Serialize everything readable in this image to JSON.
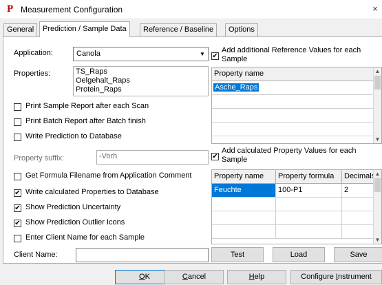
{
  "window": {
    "title": "Measurement Configuration",
    "logo": "P",
    "close_glyph": "×"
  },
  "tabs": [
    {
      "label": "General",
      "active": false
    },
    {
      "label": "Prediction / Sample Data",
      "active": true
    },
    {
      "label": "Reference / Baseline",
      "active": false
    },
    {
      "label": "Options",
      "active": false
    }
  ],
  "application": {
    "label": "Application:",
    "value": "Canola"
  },
  "properties": {
    "label": "Properties:",
    "items": [
      "TS_Raps",
      "Oelgehalt_Raps",
      "Protein_Raps"
    ]
  },
  "checks_top": [
    {
      "label": "Print Sample Report after each Scan",
      "checked": false
    },
    {
      "label": "Print Batch Report after Batch finish",
      "checked": false
    },
    {
      "label": "Write Prediction to Database",
      "checked": false
    }
  ],
  "property_suffix": {
    "label": "Property suffix:",
    "value": "-Vorh"
  },
  "checks_bottom": [
    {
      "label": "Get Formula Filename from Application Comment",
      "checked": false
    },
    {
      "label": "Write calculated Properties to Database",
      "checked": true
    },
    {
      "label": "Show Prediction Uncertainty",
      "checked": true
    },
    {
      "label": "Show Prediction Outlier Icons",
      "checked": true
    },
    {
      "label": "Enter Client Name for each Sample",
      "checked": false
    }
  ],
  "client_name": {
    "label": "Client Name:",
    "value": ""
  },
  "ref_values": {
    "check_label_1": "Add additional Reference Values for each",
    "check_label_2": "Sample",
    "checked": true,
    "column": "Property name",
    "rows": [
      "Asche_Raps"
    ]
  },
  "calc_values": {
    "check_label_1": "Add calculated Property Values for each",
    "check_label_2": "Sample",
    "checked": true,
    "columns": [
      "Property name",
      "Property formula",
      "Decimals"
    ],
    "rows": [
      [
        "Feuchte",
        "100-P1",
        "2"
      ]
    ]
  },
  "grid_buttons": {
    "test": "Test",
    "load": "Load",
    "save": "Save"
  },
  "footer": {
    "ok": "OK",
    "ok_key": "O",
    "ok_rest": "K",
    "cancel_key": "C",
    "cancel_rest": "ancel",
    "help_key": "H",
    "help_rest": "elp",
    "configure_pre": "Configure ",
    "configure_key": "I",
    "configure_rest": "nstrument"
  },
  "colors": {
    "selection": "#0078d7",
    "logo": "#c00000"
  }
}
